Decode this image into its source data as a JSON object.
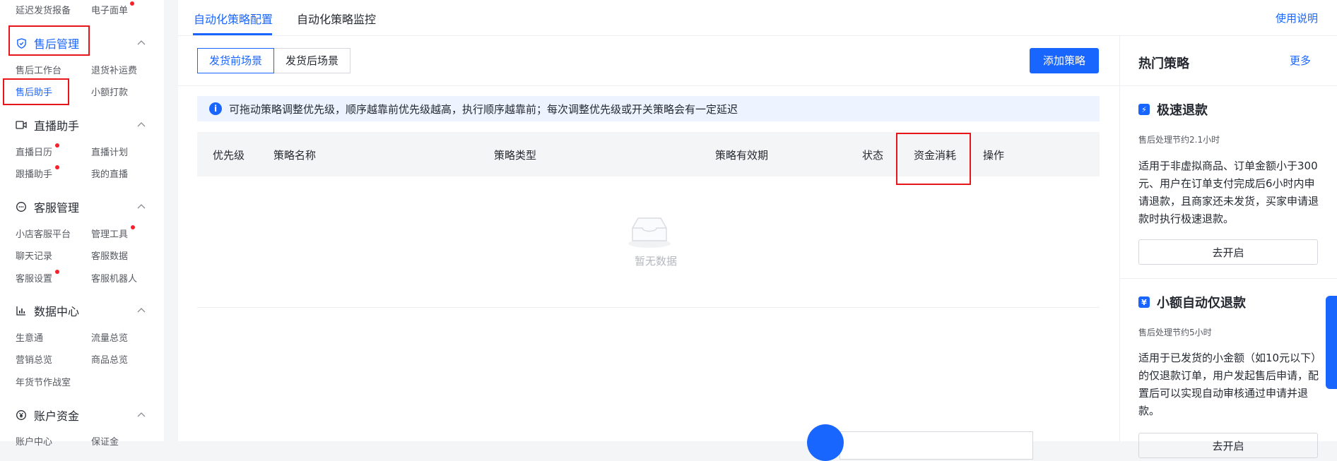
{
  "sidebar": {
    "top": {
      "left": "延迟发货报备",
      "right": "电子面单"
    },
    "sections": [
      {
        "title": "售后管理",
        "items": [
          [
            "售后工作台",
            "退货补运费"
          ],
          [
            "售后助手",
            "小额打款"
          ]
        ]
      },
      {
        "title": "直播助手",
        "items": [
          [
            "直播日历",
            "直播计划"
          ],
          [
            "跟播助手",
            "我的直播"
          ]
        ]
      },
      {
        "title": "客服管理",
        "items": [
          [
            "小店客服平台",
            "管理工具"
          ],
          [
            "聊天记录",
            "客服数据"
          ],
          [
            "客服设置",
            "客服机器人"
          ]
        ]
      },
      {
        "title": "数据中心",
        "items": [
          [
            "生意通",
            "流量总览"
          ],
          [
            "营销总览",
            "商品总览"
          ],
          [
            "年货节作战室",
            ""
          ]
        ]
      },
      {
        "title": "账户资金",
        "items": [
          [
            "账户中心",
            "保证金"
          ]
        ]
      }
    ]
  },
  "tabs": [
    "自动化策略配置",
    "自动化策略监控"
  ],
  "help_link": "使用说明",
  "scenes": [
    "发货前场景",
    "发货后场景"
  ],
  "add_button": "添加策略",
  "notice": "可拖动策略调整优先级，顺序越靠前优先级越高，执行顺序越靠前；每次调整优先级或开关策略会有一定延迟",
  "columns": [
    "优先级",
    "策略名称",
    "策略类型",
    "策略有效期",
    "状态",
    "资金消耗",
    "操作"
  ],
  "empty_text": "暂无数据",
  "hot": {
    "title": "热门策略",
    "more": "更多",
    "cards": [
      {
        "title": "极速退款",
        "sub": "售后处理节约2.1小时",
        "desc": "适用于非虚拟商品、订单金额小于300元、用户在订单支付完成后6小时内申请退款，且商家还未发货，买家申请退款时执行极速退款。",
        "button": "去开启"
      },
      {
        "title": "小额自动仅退款",
        "sub": "售后处理节约5小时",
        "desc": "适用于已发货的小金额（如10元以下）的仅退款订单，用户发起售后申请，配置后可以实现自动审核通过申请并退款。",
        "button": "去开启"
      }
    ]
  },
  "colors": {
    "accent": "#1966ff",
    "highlight": "#e8161b"
  }
}
